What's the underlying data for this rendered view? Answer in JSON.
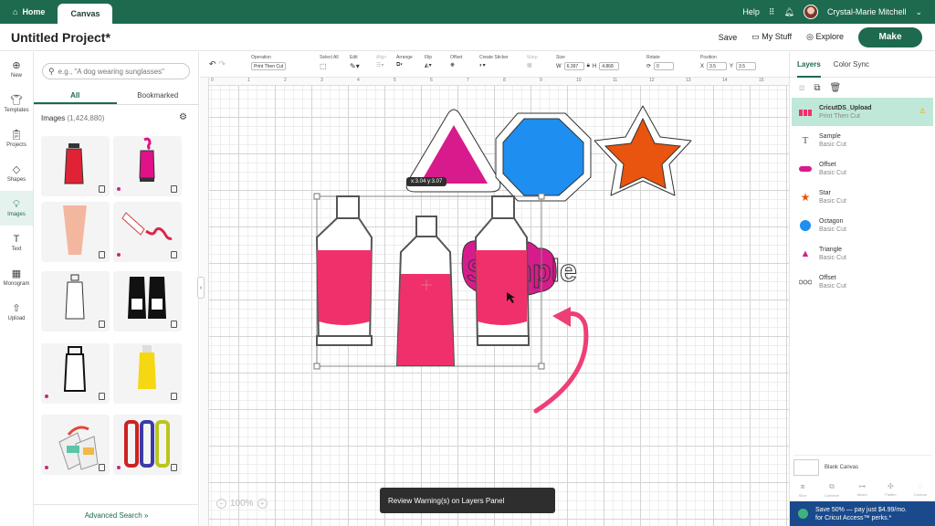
{
  "topbar": {
    "home_label": "Home",
    "canvas_label": "Canvas",
    "help_label": "Help",
    "user_name": "Crystal-Marie Mitchell"
  },
  "project": {
    "title": "Untitled Project*",
    "save_label": "Save",
    "mystuff_label": "My Stuff",
    "explore_label": "Explore",
    "make_label": "Make"
  },
  "rail": {
    "items": [
      {
        "label": "New",
        "icon": "plus-circle-icon"
      },
      {
        "label": "Templates",
        "icon": "shirt-icon"
      },
      {
        "label": "Projects",
        "icon": "clipboard-icon"
      },
      {
        "label": "Shapes",
        "icon": "shapes-icon"
      },
      {
        "label": "Images",
        "icon": "lightbulb-icon"
      },
      {
        "label": "Text",
        "icon": "text-icon"
      },
      {
        "label": "Monogram",
        "icon": "monogram-icon"
      },
      {
        "label": "Upload",
        "icon": "upload-icon"
      }
    ]
  },
  "images_panel": {
    "search_placeholder": "e.g., \"A dog wearing sunglasses\"",
    "tab_all": "All",
    "tab_bookmarked": "Bookmarked",
    "images_label": "Images",
    "images_count": "(1,424,880)",
    "advanced_search": "Advanced Search"
  },
  "toolbar": {
    "operation_label": "Operation",
    "operation_value": "Print Then Cut",
    "select_all_label": "Select All",
    "edit_label": "Edit",
    "align_label": "Align",
    "arrange_label": "Arrange",
    "flip_label": "Flip",
    "offset_label": "Offset",
    "create_sticker_label": "Create Sticker",
    "warp_label": "Warp",
    "size_label": "Size",
    "w_label": "W",
    "w_value": "6.397",
    "h_label": "H",
    "h_value": "4.868",
    "rotate_label": "Rotate",
    "rotate_value": "0",
    "position_label": "Position",
    "x_label": "X",
    "x_value": "3.5",
    "y_label": "Y",
    "y_value": "3.5"
  },
  "ruler_ticks": [
    "0",
    "1",
    "2",
    "3",
    "4",
    "5",
    "6",
    "7",
    "8",
    "9",
    "10",
    "11",
    "12",
    "13",
    "14",
    "15",
    "16"
  ],
  "canvas": {
    "tooltip": "x:3.04 y:3.07",
    "sample_text": "Sample",
    "zoom": "100%",
    "toast": "Review Warning(s) on Layers Panel"
  },
  "layers_panel": {
    "tab_layers": "Layers",
    "tab_color_sync": "Color Sync",
    "layers": [
      {
        "name": "CricutDS_Upload",
        "type": "Print Then Cut",
        "icon": "tubes-thumbnail-icon",
        "selected": true
      },
      {
        "name": "Sample",
        "type": "Basic Cut",
        "icon": "text-t-icon"
      },
      {
        "name": "Offset",
        "type": "Basic Cut",
        "icon": "offset-pink-icon"
      },
      {
        "name": "Star",
        "type": "Basic Cut",
        "icon": "star-icon"
      },
      {
        "name": "Octagon",
        "type": "Basic Cut",
        "icon": "octagon-icon"
      },
      {
        "name": "Triangle",
        "type": "Basic Cut",
        "icon": "triangle-icon"
      },
      {
        "name": "Offset",
        "type": "Basic Cut",
        "icon": "offset-outline-icon"
      }
    ],
    "blank_canvas": "Blank Canvas",
    "bottom_tools": [
      "Slice",
      "Combine",
      "Attach",
      "Flatten",
      "Contour"
    ],
    "promo_line1": "Save 50% — pay just $4.99/mo.",
    "promo_line2": "for Cricut Access™ perks.*"
  },
  "colors": {
    "brand_green": "#1d6a4f",
    "pink": "#f0306a",
    "magenta": "#d81b8c",
    "octagon_blue": "#1e8ff0",
    "star_orange": "#e9540e"
  }
}
